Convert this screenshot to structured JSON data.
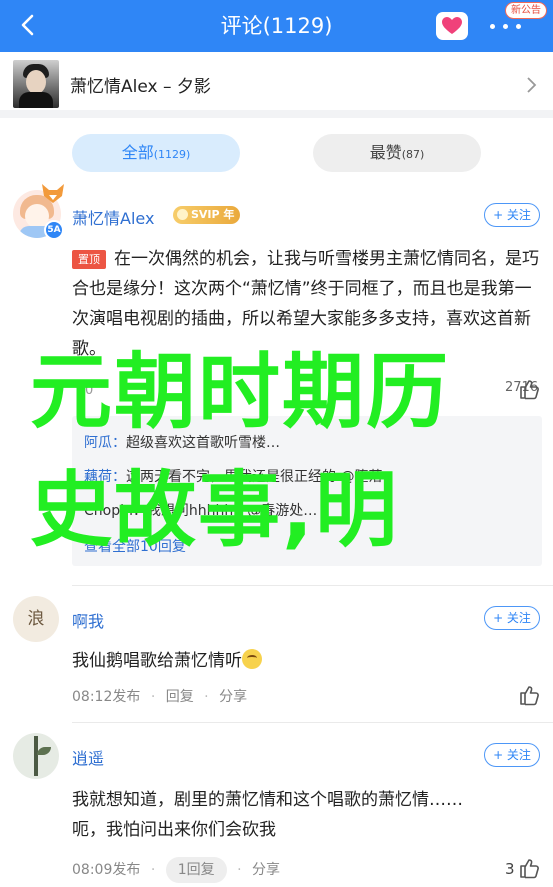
{
  "header": {
    "title": "评论(1129)",
    "notice_badge": "新公告",
    "accent": "#2f86f6"
  },
  "work": {
    "title": "萧忆情Alex – 夕影"
  },
  "sort": {
    "all_label": "全部",
    "all_count": "(1129)",
    "hot_label": "最赞",
    "hot_count": "(87)"
  },
  "comments": [
    {
      "user": "萧忆情Alex",
      "badge": "SVIP 年",
      "avatar_badge": "5A",
      "follow": "+ 关注",
      "pin": "置顶",
      "text": "在一次偶然的机会，让我与听雪楼男主萧忆情同名，是巧合也是缘分！这次两个“萧忆情”终于同框了，而且也是我第一次演唱电视剧的插曲，所以希望大家能多多支持，喜欢这首新歌。",
      "time": "0",
      "likes": "2716",
      "replies": [
        {
          "who": "阿瓜：",
          "text": "超级喜欢这首歌听雪楼…"
        },
        {
          "who": "藕荷：",
          "text": "这两天看不完，里我还是很正经的 @堕落"
        },
        {
          "who": "",
          "text": "Chopin：我想问hhhhh，@春游处…"
        }
      ],
      "reply_more": "查看全部10回复"
    },
    {
      "user": "啊我",
      "follow": "+ 关注",
      "text": "我仙鹅唱歌给萧忆情听",
      "time": "08:12发布",
      "reply": "回复",
      "share": "分享"
    },
    {
      "user": "逍遥",
      "follow": "+ 关注",
      "text_line1": "我就想知道，剧里的萧忆情和这个唱歌的萧忆情……",
      "text_line2": "呃，我怕问出来你们会砍我",
      "time": "08:09发布",
      "reply": "1回复",
      "share": "分享",
      "likes": "3"
    }
  ],
  "watermark": {
    "line1": "元朝时期历",
    "line2": "史故事,明"
  }
}
